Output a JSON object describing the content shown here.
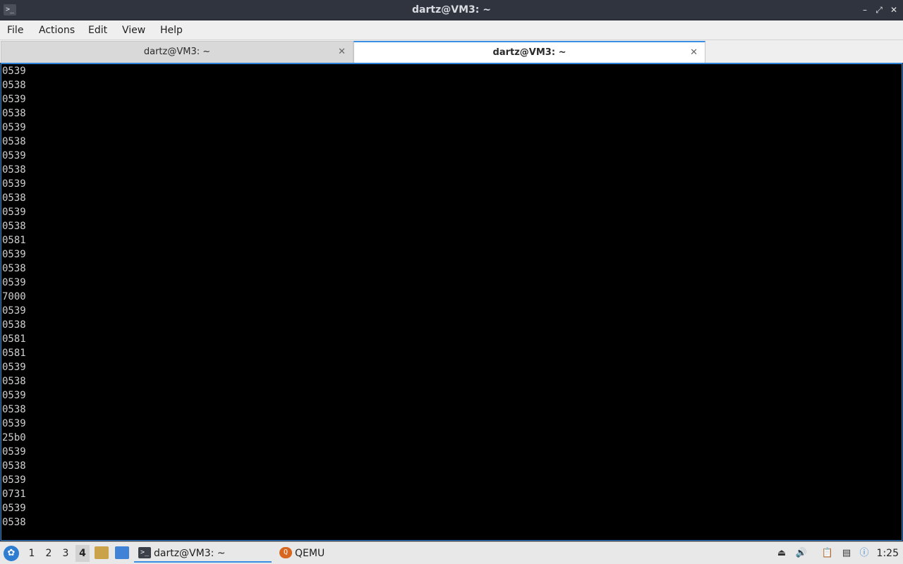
{
  "window": {
    "title": "dartz@VM3: ~",
    "app_icon": "terminal-icon",
    "buttons": {
      "minimize": "minimize-icon",
      "maximize": "maximize-icon",
      "close": "close-icon"
    }
  },
  "menubar": {
    "items": [
      "File",
      "Actions",
      "Edit",
      "View",
      "Help"
    ]
  },
  "tabs": [
    {
      "label": "dartz@VM3: ~",
      "active": false
    },
    {
      "label": "dartz@VM3: ~",
      "active": true
    }
  ],
  "terminal": {
    "lines": [
      "0539",
      "0538",
      "0539",
      "0538",
      "0539",
      "0538",
      "0539",
      "0538",
      "0539",
      "0538",
      "0539",
      "0538",
      "0581",
      "0539",
      "0538",
      "0539",
      "7000",
      "0539",
      "0538",
      "0581",
      "0581",
      "0539",
      "0538",
      "0539",
      "0538",
      "0539",
      "25b0",
      "0539",
      "0538",
      "0539",
      "0731",
      "0539",
      "0538"
    ],
    "colors": {
      "background": "#000000",
      "foreground": "#d0d0d0",
      "border": "#2d82d8"
    }
  },
  "taskbar": {
    "start_icon": "lxqt-start-icon",
    "workspaces": [
      {
        "label": "1",
        "current": false
      },
      {
        "label": "2",
        "current": false
      },
      {
        "label": "3",
        "current": false
      },
      {
        "label": "4",
        "current": true
      }
    ],
    "launchers": [
      "file-manager-icon",
      "desktop-icon"
    ],
    "tasks": [
      {
        "label": "dartz@VM3: ~",
        "icon": "terminal-icon",
        "active": true
      },
      {
        "label": "QEMU",
        "icon": "qemu-icon",
        "active": false
      }
    ],
    "tray": [
      "eject-icon",
      "volume-icon",
      "clipboard-icon",
      "network-icon",
      "notification-icon"
    ],
    "clock": "1:25"
  }
}
